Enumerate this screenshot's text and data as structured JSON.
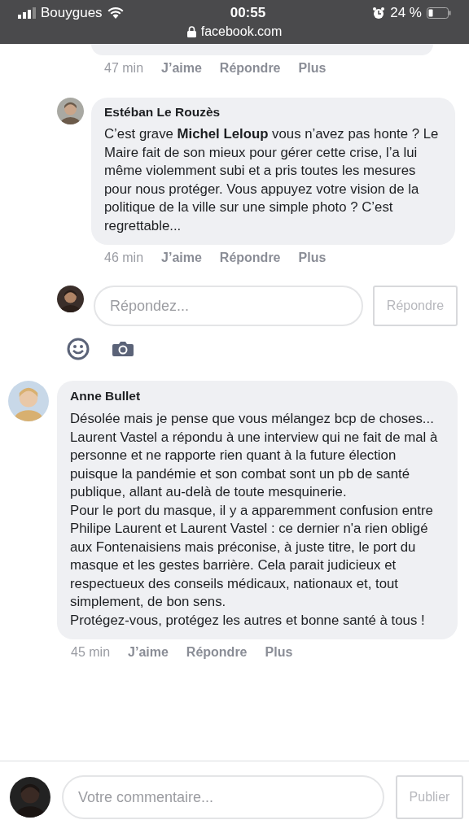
{
  "status_bar": {
    "carrier": "Bouygues",
    "time": "00:55",
    "battery": "24 %",
    "url": "facebook.com"
  },
  "top_actions": {
    "time": "47 min",
    "like": "J’aime",
    "reply": "Répondre",
    "more": "Plus"
  },
  "reply": {
    "author": "Estéban Le Rouzès",
    "text": "C’est grave **Michel Leloup** vous n’avez pas honte ? Le Maire fait de son mieux pour gérer cette crise, l’a lui même violemment subi et a pris toutes les mesures pour nous protéger. Vous appuyez votre vision de la politique de la ville sur une simple photo ? C’est regrettable...",
    "time": "46 min",
    "like": "J’aime",
    "reply": "Répondre",
    "more": "Plus"
  },
  "reply_box": {
    "placeholder": "Répondez...",
    "button": "Répondre"
  },
  "comment": {
    "author": "Anne Bullet",
    "paragraphs": [
      "Désolée mais je pense que vous mélangez bcp de choses... Laurent Vastel a répondu à une interview qui ne fait de mal à personne et ne rapporte rien quant à la future élection puisque la pandémie et son combat sont un pb de santé publique, allant au-delà de toute mesquinerie.",
      "Pour le port du masque, il y a apparemment confusion entre Philipe Laurent et Laurent Vastel : ce dernier n'a rien obligé aux Fontenaisiens mais préconise, à juste titre, le port du masque et les gestes barrière. Cela parait judicieux et respectueux des conseils médicaux, nationaux et, tout simplement, de bon sens.",
      "Protégez-vous, protégez les autres et bonne santé à tous !"
    ],
    "time": "45 min",
    "like": "J’aime",
    "reply": "Répondre",
    "more": "Plus"
  },
  "comment_box": {
    "placeholder": "Votre commentaire...",
    "button": "Publier"
  }
}
